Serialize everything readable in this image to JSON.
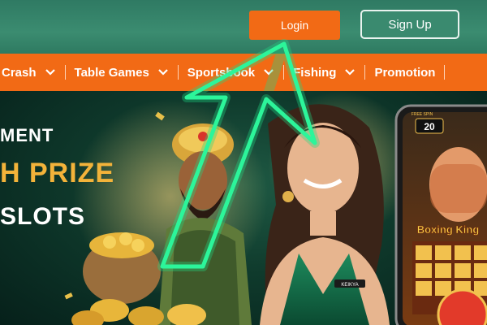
{
  "header": {
    "login_label": "Login",
    "signup_label": "Sign Up"
  },
  "nav": {
    "items": [
      {
        "label": "Crash",
        "icon": "chevron-down-icon"
      },
      {
        "label": "Table Games",
        "icon": "chevron-down-icon"
      },
      {
        "label": "Sportsbook",
        "icon": "chevron-down-icon"
      },
      {
        "label": "Fishing",
        "icon": "chevron-down-icon"
      },
      {
        "label": "Promotion"
      }
    ]
  },
  "banner": {
    "line1": "MENT",
    "line2": "H PRIZE",
    "line3": "SLOTS",
    "phone_badge": "20",
    "phone_top_label": "FREE SPIN",
    "phone_game_title": "Boxing King",
    "dress_label": "KEIKYA"
  },
  "colors": {
    "header_bg": "#3b8c70",
    "accent_orange": "#f26a15",
    "nav_text": "#ffffff",
    "prize_gold": "#f3b33a",
    "arrow_glow": "#2cf59a"
  }
}
